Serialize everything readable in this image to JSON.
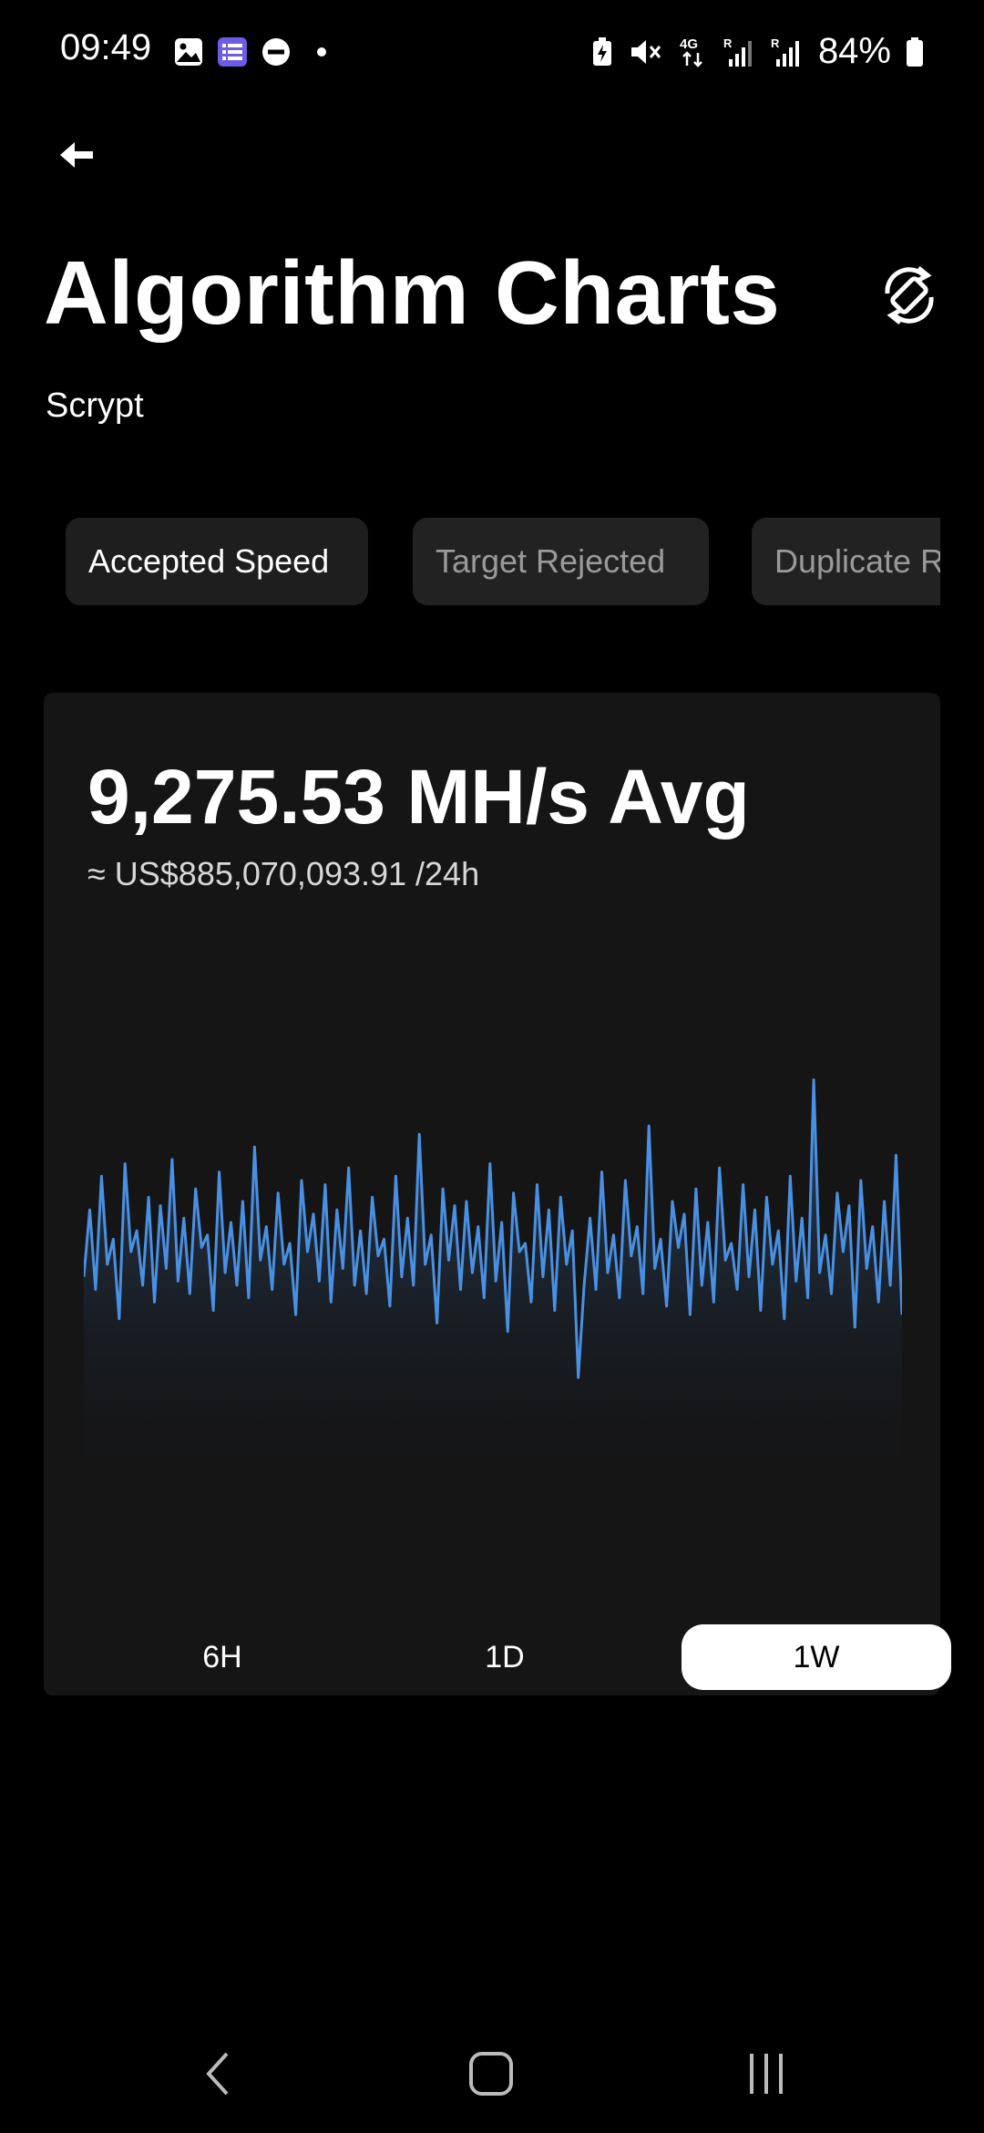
{
  "status_bar": {
    "time": "09:49",
    "battery": "84%",
    "left_icons": [
      "gallery-icon",
      "list-app-icon",
      "do-not-disturb-icon",
      "notification-dot-icon"
    ],
    "right_icons": [
      "battery-saver-icon",
      "mute-icon",
      "4g-data-icon",
      "signal-icon",
      "signal-icon",
      "battery-icon"
    ]
  },
  "header": {
    "title": "Algorithm Charts",
    "subtitle": "Scrypt"
  },
  "tabs": [
    {
      "label": "Accepted Speed",
      "active": true
    },
    {
      "label": "Target Rejected",
      "active": false
    },
    {
      "label": "Duplicate R",
      "active": false
    }
  ],
  "card": {
    "value": "9,275.53 MH/s Avg",
    "usd": "≈ US$885,070,093.91 /24h"
  },
  "chart_data": {
    "type": "area",
    "series": [
      {
        "values": [
          5.2,
          6.8,
          4.9,
          7.6,
          5.5,
          6.1,
          4.2,
          7.9,
          5.8,
          6.3,
          5.0,
          7.1,
          4.6,
          6.9,
          5.4,
          8.0,
          5.1,
          6.6,
          4.8,
          7.3,
          5.9,
          6.2,
          4.4,
          7.7,
          5.3,
          6.5,
          5.0,
          7.0,
          4.7,
          8.3,
          5.6,
          6.4,
          4.9,
          7.2,
          5.5,
          6.0,
          4.3,
          7.5,
          5.8,
          6.7,
          5.1,
          7.4,
          4.6,
          6.8,
          5.4,
          7.8,
          5.0,
          6.3,
          4.8,
          7.1,
          5.7,
          6.1,
          4.5,
          7.6,
          5.2,
          6.6,
          5.0,
          8.6,
          5.5,
          6.2,
          4.1,
          7.3,
          5.6,
          6.9,
          4.9,
          7.0,
          5.3,
          6.4,
          4.7,
          7.9,
          5.1,
          6.5,
          3.9,
          7.2,
          5.8,
          6.0,
          4.6,
          7.4,
          5.2,
          6.8,
          4.4,
          7.1,
          5.5,
          6.3,
          2.8,
          5.0,
          6.6,
          4.9,
          7.7,
          5.3,
          6.2,
          4.7,
          7.5,
          5.7,
          6.4,
          4.8,
          8.8,
          5.4,
          6.1,
          4.5,
          7.0,
          5.9,
          6.7,
          4.3,
          7.3,
          5.0,
          6.5,
          4.6,
          7.8,
          5.6,
          6.0,
          4.9,
          7.4,
          5.2,
          6.8,
          4.4,
          7.1,
          5.5,
          6.3,
          4.2,
          7.6,
          5.1,
          6.6,
          4.7,
          9.9,
          5.3,
          6.2,
          4.8,
          7.2,
          5.8,
          6.9,
          4.0,
          7.5,
          5.4,
          6.4,
          4.6,
          7.0,
          5.0,
          8.1,
          4.3
        ]
      }
    ],
    "ylim": [
      0,
      10
    ],
    "grid": false,
    "color": "#4a90e2"
  },
  "ranges": [
    {
      "label": "6H",
      "active": false
    },
    {
      "label": "1D",
      "active": false
    },
    {
      "label": "1W",
      "active": true
    }
  ],
  "nav": {
    "icons": [
      "back-nav-icon",
      "home-nav-icon",
      "recents-nav-icon"
    ]
  }
}
